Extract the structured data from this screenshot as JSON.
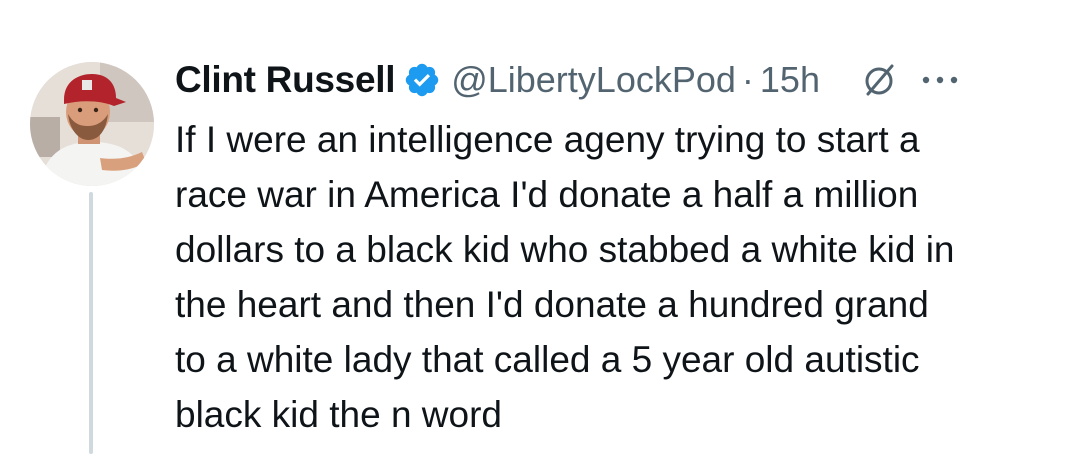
{
  "tweet": {
    "display_name": "Clint Russell",
    "handle": "@LibertyLockPod",
    "separator": "·",
    "timestamp": "15h",
    "body_lines": [
      "If I were an intelligence ageny trying to start a",
      "race war in America I'd donate a half a million",
      "dollars to a black kid who stabbed a white kid in",
      "the heart and then I'd donate a hundred grand",
      "to a white lady that called a 5 year old autistic",
      "black kid the n word"
    ]
  },
  "icons": {
    "verified": "verified-badge-icon",
    "grok": "grok-icon",
    "more": "more-options-icon"
  },
  "colors": {
    "text_primary": "#0f1419",
    "text_secondary": "#536471",
    "verified_blue": "#1d9bf0",
    "thread_line": "#cfd9de"
  }
}
